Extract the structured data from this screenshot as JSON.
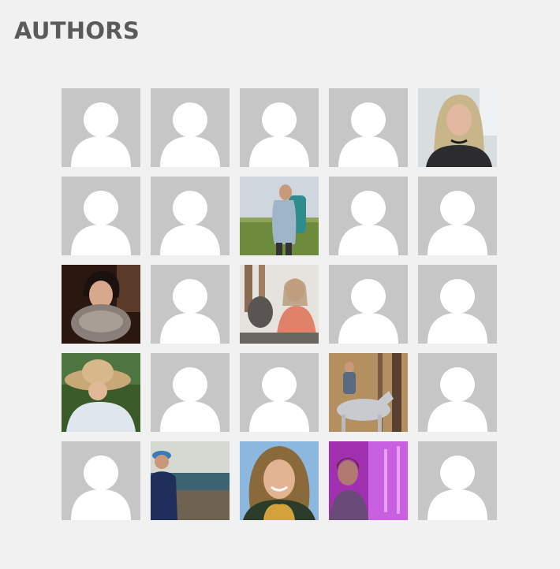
{
  "section": {
    "title": "AUTHORS"
  },
  "authors": [
    {
      "kind": "default"
    },
    {
      "kind": "default"
    },
    {
      "kind": "default"
    },
    {
      "kind": "default"
    },
    {
      "kind": "photo",
      "photo": "woman-blonde"
    },
    {
      "kind": "default"
    },
    {
      "kind": "default"
    },
    {
      "kind": "photo",
      "photo": "hiker-backpack"
    },
    {
      "kind": "default"
    },
    {
      "kind": "default"
    },
    {
      "kind": "photo",
      "photo": "woman-fur-collar"
    },
    {
      "kind": "default"
    },
    {
      "kind": "photo",
      "photo": "woman-with-owl"
    },
    {
      "kind": "default"
    },
    {
      "kind": "default"
    },
    {
      "kind": "photo",
      "photo": "woman-straw-hat"
    },
    {
      "kind": "default"
    },
    {
      "kind": "default"
    },
    {
      "kind": "photo",
      "photo": "rider-horse"
    },
    {
      "kind": "default"
    },
    {
      "kind": "default"
    },
    {
      "kind": "photo",
      "photo": "person-blue-cap"
    },
    {
      "kind": "photo",
      "photo": "woman-curly-hair"
    },
    {
      "kind": "photo",
      "photo": "woman-purple-light"
    },
    {
      "kind": "default"
    }
  ],
  "colors": {
    "background": "#f2f1f1",
    "placeholder_bg": "#c6c6c6",
    "placeholder_figure": "#ffffff",
    "heading": "#5a5a5a"
  }
}
